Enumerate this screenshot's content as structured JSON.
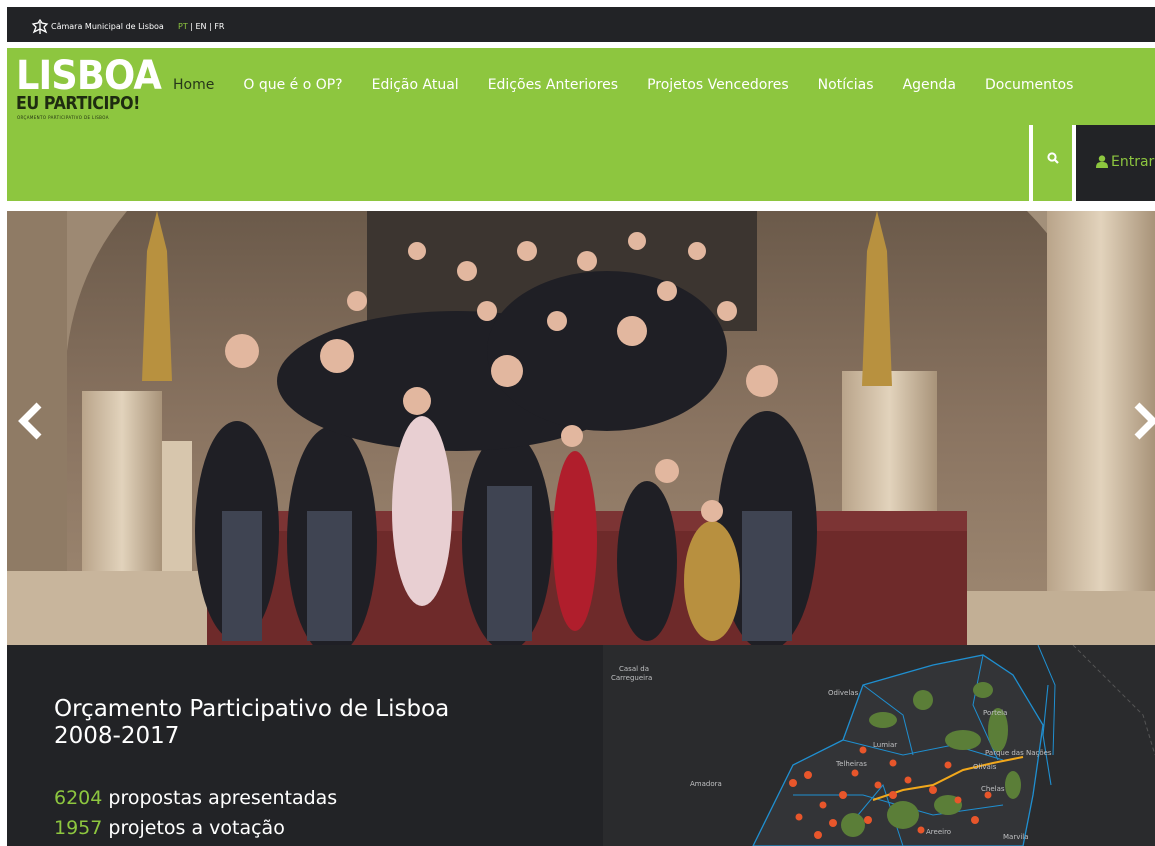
{
  "topbar": {
    "org_name": "Câmara Municipal de Lisboa",
    "lang_pt": "PT",
    "lang_sep1": " | ",
    "lang_en": "EN",
    "lang_sep2": " | ",
    "lang_fr": "FR"
  },
  "logo": {
    "line1": "LISBOA",
    "line2": "EU PARTICIPO!",
    "line3": "ORÇAMENTO PARTICIPATIVO DE LISBOA"
  },
  "nav": {
    "items": [
      "Home",
      "O que é o OP?",
      "Edição Atual",
      "Edições Anteriores",
      "Projetos Vencedores",
      "Notícias",
      "Agenda",
      "Documentos"
    ]
  },
  "header_actions": {
    "login_label": "Entrar"
  },
  "stats": {
    "title_line1": "Orçamento Participativo de Lisboa",
    "title_line2": "2008-2017",
    "proposals_count": "6204",
    "proposals_label": " propostas apresentadas",
    "projects_count": "1957",
    "projects_label": " projetos a votação"
  },
  "map": {
    "labels": [
      "Casal da",
      "Carregueira",
      "Odivelas",
      "Portela",
      "Lumiar",
      "Parque das Nações",
      "Olivais",
      "Telheiras",
      "Chelas",
      "Amadora",
      "Areeiro",
      "Marvila"
    ]
  },
  "colors": {
    "brand_green": "#8dc63f",
    "dark": "#222326"
  }
}
